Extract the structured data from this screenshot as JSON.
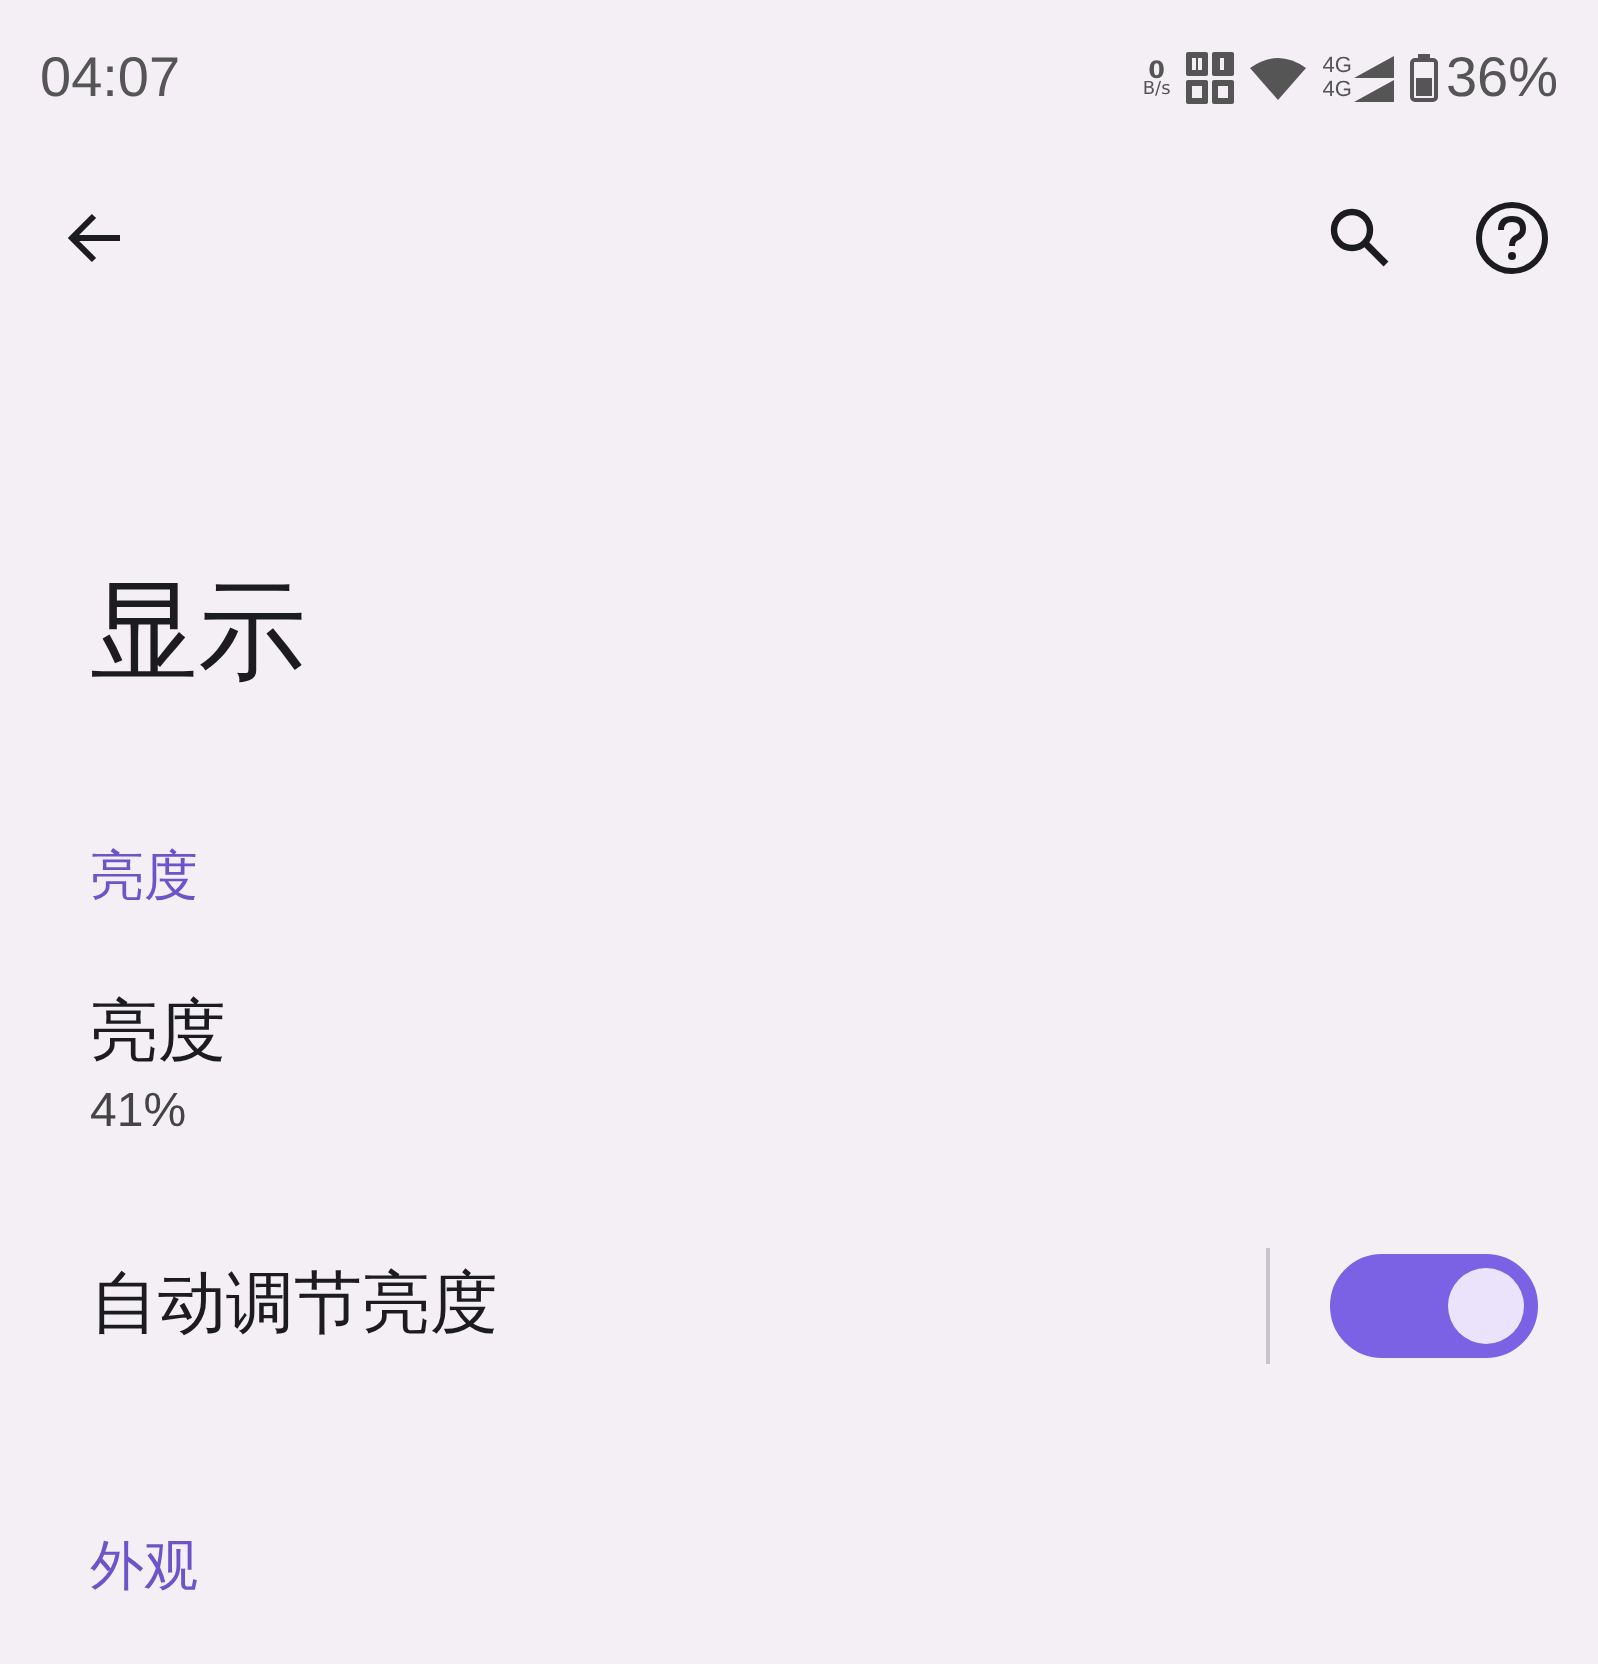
{
  "status_bar": {
    "time": "04:07",
    "net_speed_value": "0",
    "net_speed_unit": "B/s",
    "network_types": [
      "4G",
      "4G"
    ],
    "battery": "36%"
  },
  "toolbar": {
    "actions": [
      {
        "kind": "back"
      },
      {
        "kind": "search"
      },
      {
        "kind": "help"
      }
    ]
  },
  "title": "显示",
  "sections": [
    {
      "header": "亮度",
      "items": [
        {
          "kind": "text",
          "title": "亮度",
          "summary": "41%"
        },
        {
          "kind": "switch",
          "title": "自动调节亮度",
          "on": true
        }
      ]
    },
    {
      "header": "外观"
    }
  ]
}
